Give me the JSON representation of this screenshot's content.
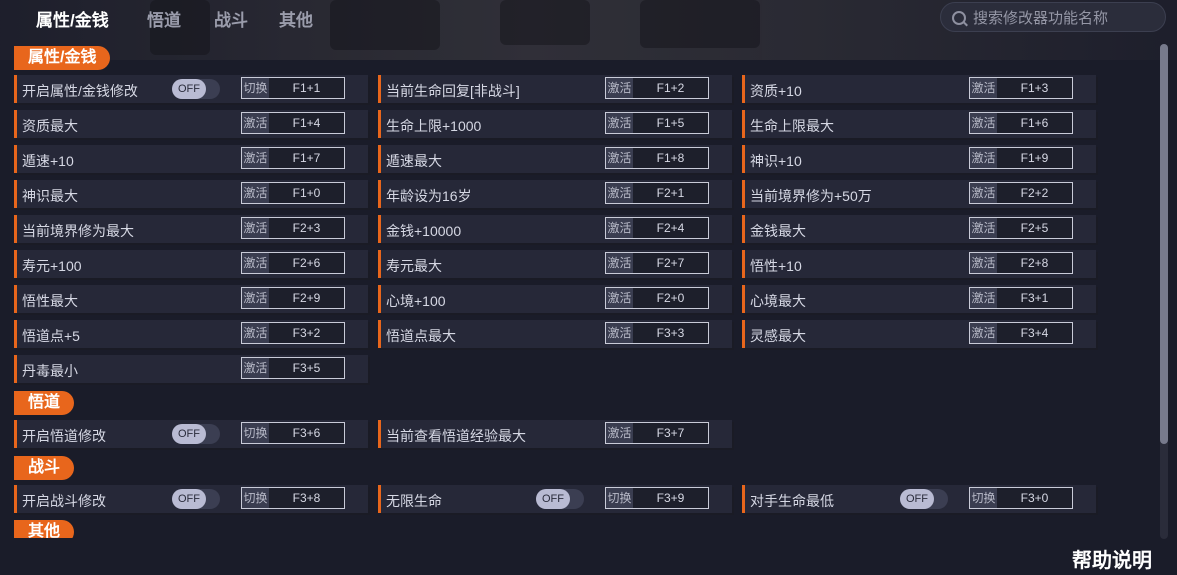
{
  "tabs": [
    "属性/金钱",
    "悟道",
    "战斗",
    "其他"
  ],
  "search": {
    "placeholder": "搜索修改器功能名称"
  },
  "sections": {
    "s1": {
      "title": "属性/金钱",
      "rows": [
        {
          "label": "开启属性/金钱修改",
          "toggle": "OFF",
          "action": "切换",
          "key": "F1+1"
        },
        {
          "label": "当前生命回复[非战斗]",
          "action": "激活",
          "key": "F1+2"
        },
        {
          "label": "资质+10",
          "action": "激活",
          "key": "F1+3"
        },
        {
          "label": "资质最大",
          "action": "激活",
          "key": "F1+4"
        },
        {
          "label": "生命上限+1000",
          "action": "激活",
          "key": "F1+5"
        },
        {
          "label": "生命上限最大",
          "action": "激活",
          "key": "F1+6"
        },
        {
          "label": "遁速+10",
          "action": "激活",
          "key": "F1+7"
        },
        {
          "label": "遁速最大",
          "action": "激活",
          "key": "F1+8"
        },
        {
          "label": "神识+10",
          "action": "激活",
          "key": "F1+9"
        },
        {
          "label": "神识最大",
          "action": "激活",
          "key": "F1+0"
        },
        {
          "label": "年龄设为16岁",
          "action": "激活",
          "key": "F2+1"
        },
        {
          "label": "当前境界修为+50万",
          "action": "激活",
          "key": "F2+2"
        },
        {
          "label": "当前境界修为最大",
          "action": "激活",
          "key": "F2+3"
        },
        {
          "label": "金钱+10000",
          "action": "激活",
          "key": "F2+4"
        },
        {
          "label": "金钱最大",
          "action": "激活",
          "key": "F2+5"
        },
        {
          "label": "寿元+100",
          "action": "激活",
          "key": "F2+6"
        },
        {
          "label": "寿元最大",
          "action": "激活",
          "key": "F2+7"
        },
        {
          "label": "悟性+10",
          "action": "激活",
          "key": "F2+8"
        },
        {
          "label": "悟性最大",
          "action": "激活",
          "key": "F2+9"
        },
        {
          "label": "心境+100",
          "action": "激活",
          "key": "F2+0"
        },
        {
          "label": "心境最大",
          "action": "激活",
          "key": "F3+1"
        },
        {
          "label": "悟道点+5",
          "action": "激活",
          "key": "F3+2"
        },
        {
          "label": "悟道点最大",
          "action": "激活",
          "key": "F3+3"
        },
        {
          "label": "灵感最大",
          "action": "激活",
          "key": "F3+4"
        },
        {
          "label": "丹毒最小",
          "action": "激活",
          "key": "F3+5"
        }
      ]
    },
    "s2": {
      "title": "悟道",
      "rows": [
        {
          "label": "开启悟道修改",
          "toggle": "OFF",
          "action": "切换",
          "key": "F3+6"
        },
        {
          "label": "当前查看悟道经验最大",
          "action": "激活",
          "key": "F3+7"
        }
      ]
    },
    "s3": {
      "title": "战斗",
      "rows": [
        {
          "label": "开启战斗修改",
          "toggle": "OFF",
          "action": "切换",
          "key": "F3+8"
        },
        {
          "label": "无限生命",
          "toggle": "OFF",
          "action": "切换",
          "key": "F3+9"
        },
        {
          "label": "对手生命最低",
          "toggle": "OFF",
          "action": "切换",
          "key": "F3+0"
        }
      ]
    },
    "s4": {
      "title": "其他"
    }
  },
  "help_label": "帮助说明",
  "colors": {
    "accent": "#e8661c",
    "background": "#1a1c29",
    "row": "#262838"
  },
  "icons": {
    "search": "search-icon"
  }
}
